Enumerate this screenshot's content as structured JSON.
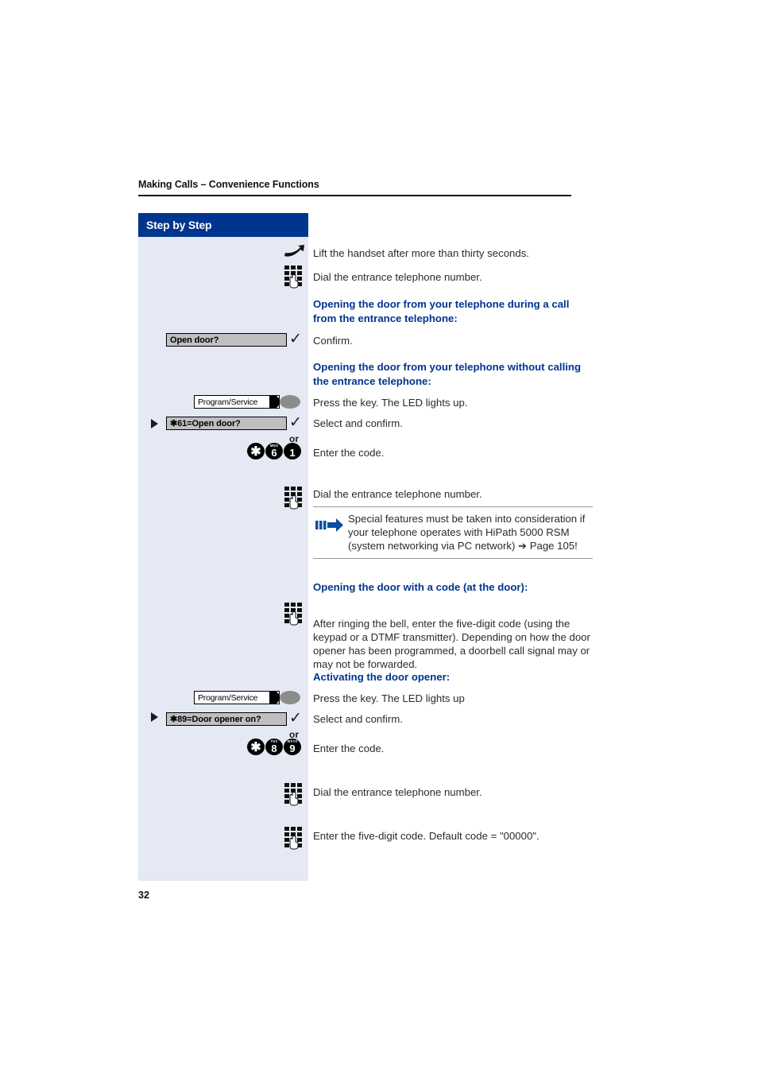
{
  "header": {
    "running_title": "Making Calls – Convenience Functions"
  },
  "sidebar": {
    "title": "Step by Step",
    "items": [
      {
        "id": "open-door-softkey",
        "type": "display-option",
        "label": "Open door?"
      },
      {
        "id": "program-service-key-1",
        "type": "function-key",
        "label": "Program/Service"
      },
      {
        "id": "star61-open-door-option",
        "type": "display-option",
        "label": "✱61=Open door?"
      },
      {
        "id": "code-star-6-1",
        "type": "code-keys",
        "keys": [
          "✱",
          "6",
          "1"
        ],
        "sublabels": [
          "",
          "MNO",
          ""
        ]
      },
      {
        "id": "program-service-key-2",
        "type": "function-key",
        "label": "Program/Service"
      },
      {
        "id": "star89-door-opener-option",
        "type": "display-option",
        "label": "✱89=Door opener on?"
      },
      {
        "id": "code-star-8-9",
        "type": "code-keys",
        "keys": [
          "✱",
          "8",
          "9"
        ],
        "sublabels": [
          "",
          "TUV",
          "WXYZ"
        ]
      }
    ],
    "or_label": "or"
  },
  "main": {
    "steps": [
      {
        "id": "lift-handset",
        "icon": "handset-icon",
        "text": "Lift the handset after more than thirty seconds."
      },
      {
        "id": "dial-entrance-1",
        "icon": "keypad-icon",
        "text": "Dial the entrance telephone number."
      }
    ],
    "heading_1": "Opening the door from your telephone during a call from the entrance telephone:",
    "confirm_text": "Confirm.",
    "heading_2": "Opening the door from your telephone without calling the entrance telephone:",
    "press_key_text_1": "Press the key. The LED lights up.",
    "select_confirm_text_1": "Select and confirm.",
    "enter_code_text_1": "Enter the code.",
    "dial_entrance_text_2": "Dial the entrance telephone number.",
    "note": {
      "icon": "note-arrow-icon",
      "text": "Special features must be taken into consideration if your telephone operates with HiPath 5000 RSM (system networking via PC network) ➔ Page 105!"
    },
    "heading_3": "Opening the door with a code (at the door):",
    "code_paragraph": "After ringing the bell, enter the five-digit code (using the keypad or a DTMF transmitter). Depending on how the door opener has been programmed, a doorbell call signal may or may not be forwarded.",
    "heading_4": "Activating the door opener:",
    "press_key_text_2": "Press the key. The LED lights up",
    "select_confirm_text_2": "Select and confirm.",
    "enter_code_text_2": "Enter the code.",
    "dial_entrance_text_3": "Dial the entrance telephone number.",
    "enter_five_digit_text": "Enter the five-digit code. Default code = \"00000\"."
  },
  "footer": {
    "page_number": "32"
  },
  "colors": {
    "brand_blue": "#00358e",
    "sidebar_bg": "#e4e9f4",
    "display_gray": "#bfbfbf",
    "led_gray": "#8c8c8c"
  }
}
